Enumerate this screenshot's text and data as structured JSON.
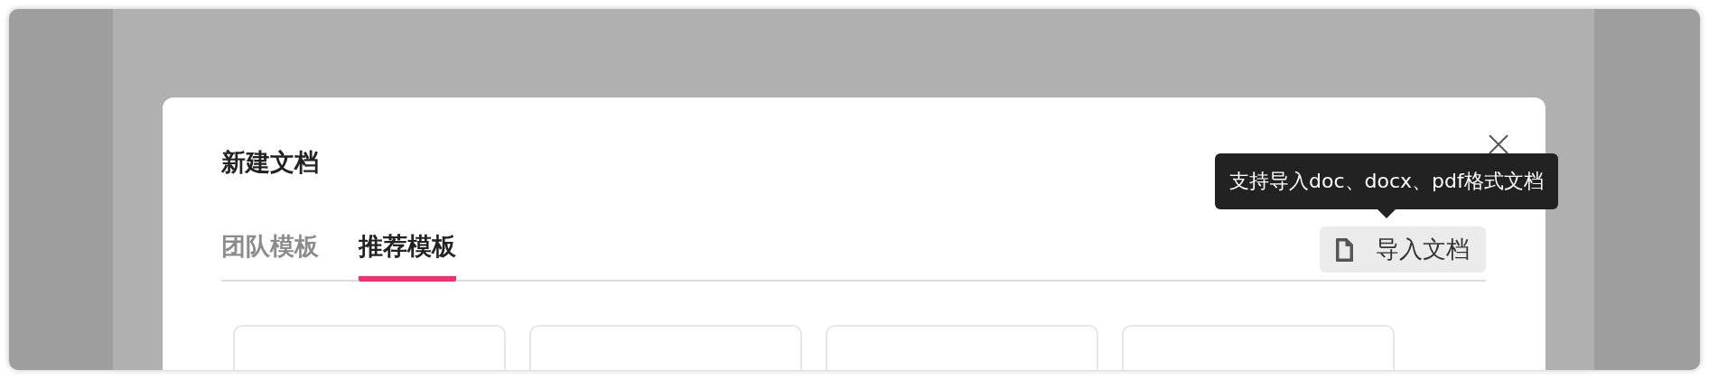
{
  "dialog": {
    "title": "新建文档",
    "tabs": [
      {
        "label": "团队模板",
        "selected": false
      },
      {
        "label": "推荐模板",
        "selected": true
      }
    ],
    "import_button": {
      "label": "导入文档"
    },
    "tooltip": {
      "text": "支持导入doc、docx、pdf格式文档"
    },
    "template_cards": [
      {
        "kind": "template"
      },
      {
        "kind": "template"
      },
      {
        "kind": "template"
      },
      {
        "kind": "template"
      }
    ]
  }
}
